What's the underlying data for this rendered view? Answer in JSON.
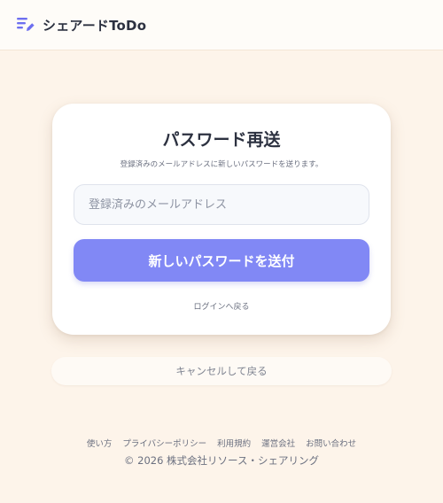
{
  "header": {
    "app_title": "シェアードToDo",
    "logo_icon": "list-edit-icon",
    "accent_color": "#6d6ff0"
  },
  "card": {
    "title": "パスワード再送",
    "subtitle": "登録済みのメールアドレスに新しいパスワードを送ります。",
    "email_placeholder": "登録済みのメールアドレス",
    "submit_label": "新しいパスワードを送付",
    "login_link": "ログインへ戻る",
    "button_color": "#8188f5"
  },
  "cancel_label": "キャンセルして戻る",
  "footer": {
    "links": [
      "使い方",
      "プライバシーポリシー",
      "利用規約",
      "運営会社",
      "お問い合わせ"
    ],
    "copyright": "© 2026 株式会社リソース・シェアリング"
  }
}
